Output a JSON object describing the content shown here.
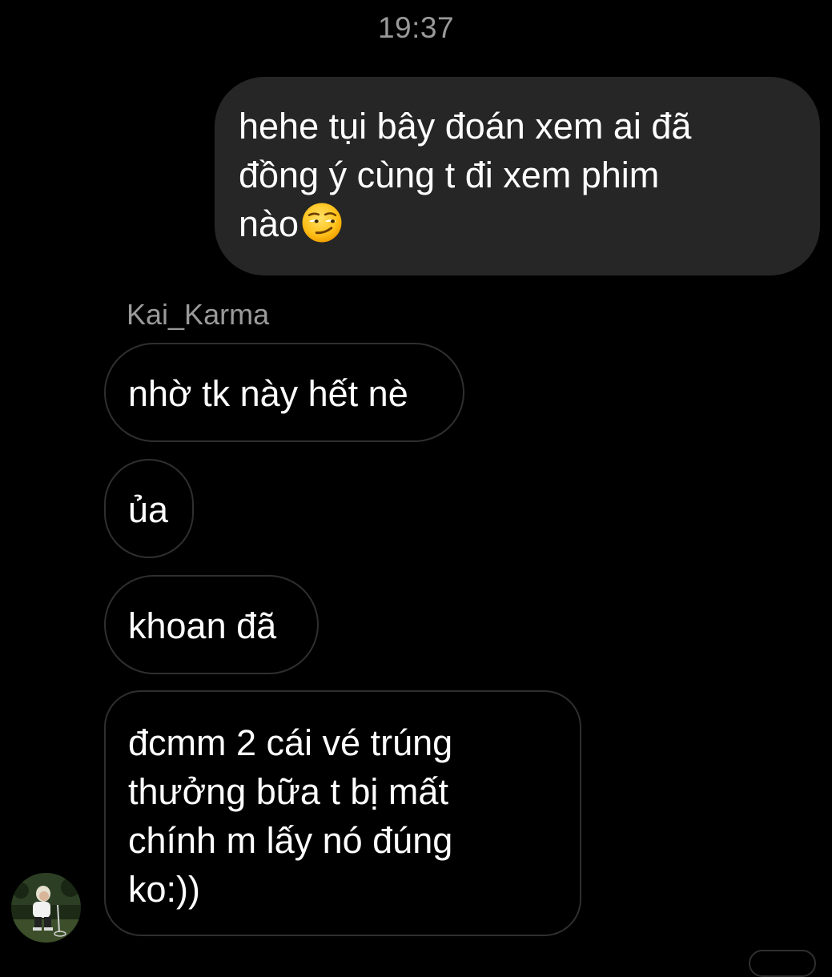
{
  "chat": {
    "timestamp": "19:37",
    "sent_message": {
      "text": "hehe tụi bây đoán xem ai đã\nđồng ý cùng t đi xem phim\nnào",
      "emoji": "smirking-face-emoji"
    },
    "sender_name": "Kai_Karma",
    "received_messages": [
      "nhờ tk này hết nè",
      "ủa",
      "khoan đã",
      "đcmm 2 cái vé trúng\nthưởng bữa t bị mất\nchính m lấy nó đúng\nko:))"
    ],
    "avatar": "user-avatar-photo"
  },
  "colors": {
    "background": "#000000",
    "sent_bubble": "#262626",
    "received_border": "#2f2f2f",
    "meta_text": "#9a9a9a",
    "message_text": "#ffffff"
  }
}
